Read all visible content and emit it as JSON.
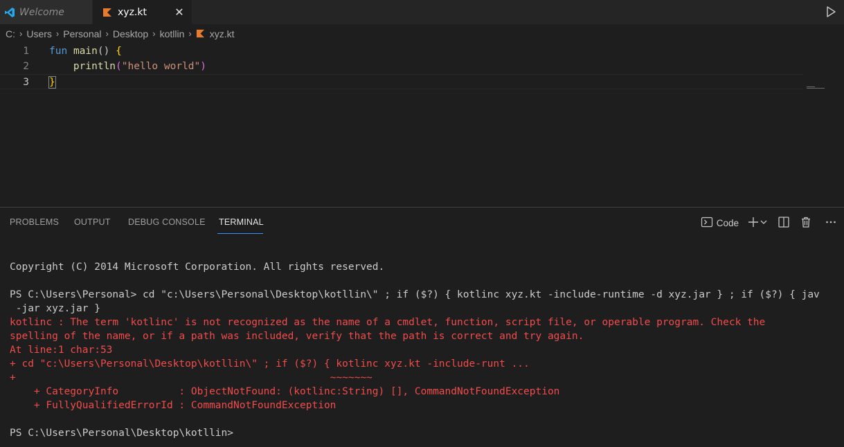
{
  "tabs": [
    {
      "label": "Welcome",
      "icon": "vscode-icon"
    },
    {
      "label": "xyz.kt",
      "icon": "kotlin-icon",
      "close": "✕"
    }
  ],
  "breadcrumb": {
    "parts": [
      "C:",
      "Users",
      "Personal",
      "Desktop",
      "kotllin"
    ],
    "file": "xyz.kt"
  },
  "editor": {
    "line_numbers": [
      "1",
      "2",
      "3"
    ],
    "code": {
      "l1_kw": "fun",
      "l1_fn": "main",
      "l1_paren": "()",
      "l1_brace": "{",
      "l2_fn": "println",
      "l2_open": "(",
      "l2_str": "\"hello world\"",
      "l2_close": ")",
      "l3_brace": "}"
    }
  },
  "panel": {
    "tabs": [
      "PROBLEMS",
      "OUTPUT",
      "DEBUG CONSOLE",
      "TERMINAL"
    ],
    "active_tab": "TERMINAL",
    "terminal_name": "Code"
  },
  "terminal": {
    "lines": [
      {
        "text": "Copyright (C) 2014 Microsoft Corporation. All rights reserved.",
        "kind": "normal"
      },
      {
        "text": "",
        "kind": "normal"
      },
      {
        "text": "PS C:\\Users\\Personal> cd \"c:\\Users\\Personal\\Desktop\\kotllin\\\" ; if ($?) { kotlinc xyz.kt -include-runtime -d xyz.jar } ; if ($?) { jav",
        "kind": "normal"
      },
      {
        "text": " -jar xyz.jar }",
        "kind": "normal"
      },
      {
        "text": "kotlinc : The term 'kotlinc' is not recognized as the name of a cmdlet, function, script file, or operable program. Check the",
        "kind": "error"
      },
      {
        "text": "spelling of the name, or if a path was included, verify that the path is correct and try again.",
        "kind": "error"
      },
      {
        "text": "At line:1 char:53",
        "kind": "error"
      },
      {
        "text": "+ cd \"c:\\Users\\Personal\\Desktop\\kotllin\\\" ; if ($?) { kotlinc xyz.kt -include-runt ...",
        "kind": "error"
      },
      {
        "text": "+                                                    ~~~~~~~",
        "kind": "error"
      },
      {
        "text": "    + CategoryInfo          : ObjectNotFound: (kotlinc:String) [], CommandNotFoundException",
        "kind": "error"
      },
      {
        "text": "    + FullyQualifiedErrorId : CommandNotFoundException",
        "kind": "error"
      },
      {
        "text": "",
        "kind": "normal"
      },
      {
        "text": "PS C:\\Users\\Personal\\Desktop\\kotllin>",
        "kind": "normal"
      }
    ]
  },
  "colors": {
    "accent": "#3794ff",
    "kotlin_orange": "#e87b2f",
    "vscode_blue": "#23a9f2",
    "error_red": "#f14c4c"
  }
}
